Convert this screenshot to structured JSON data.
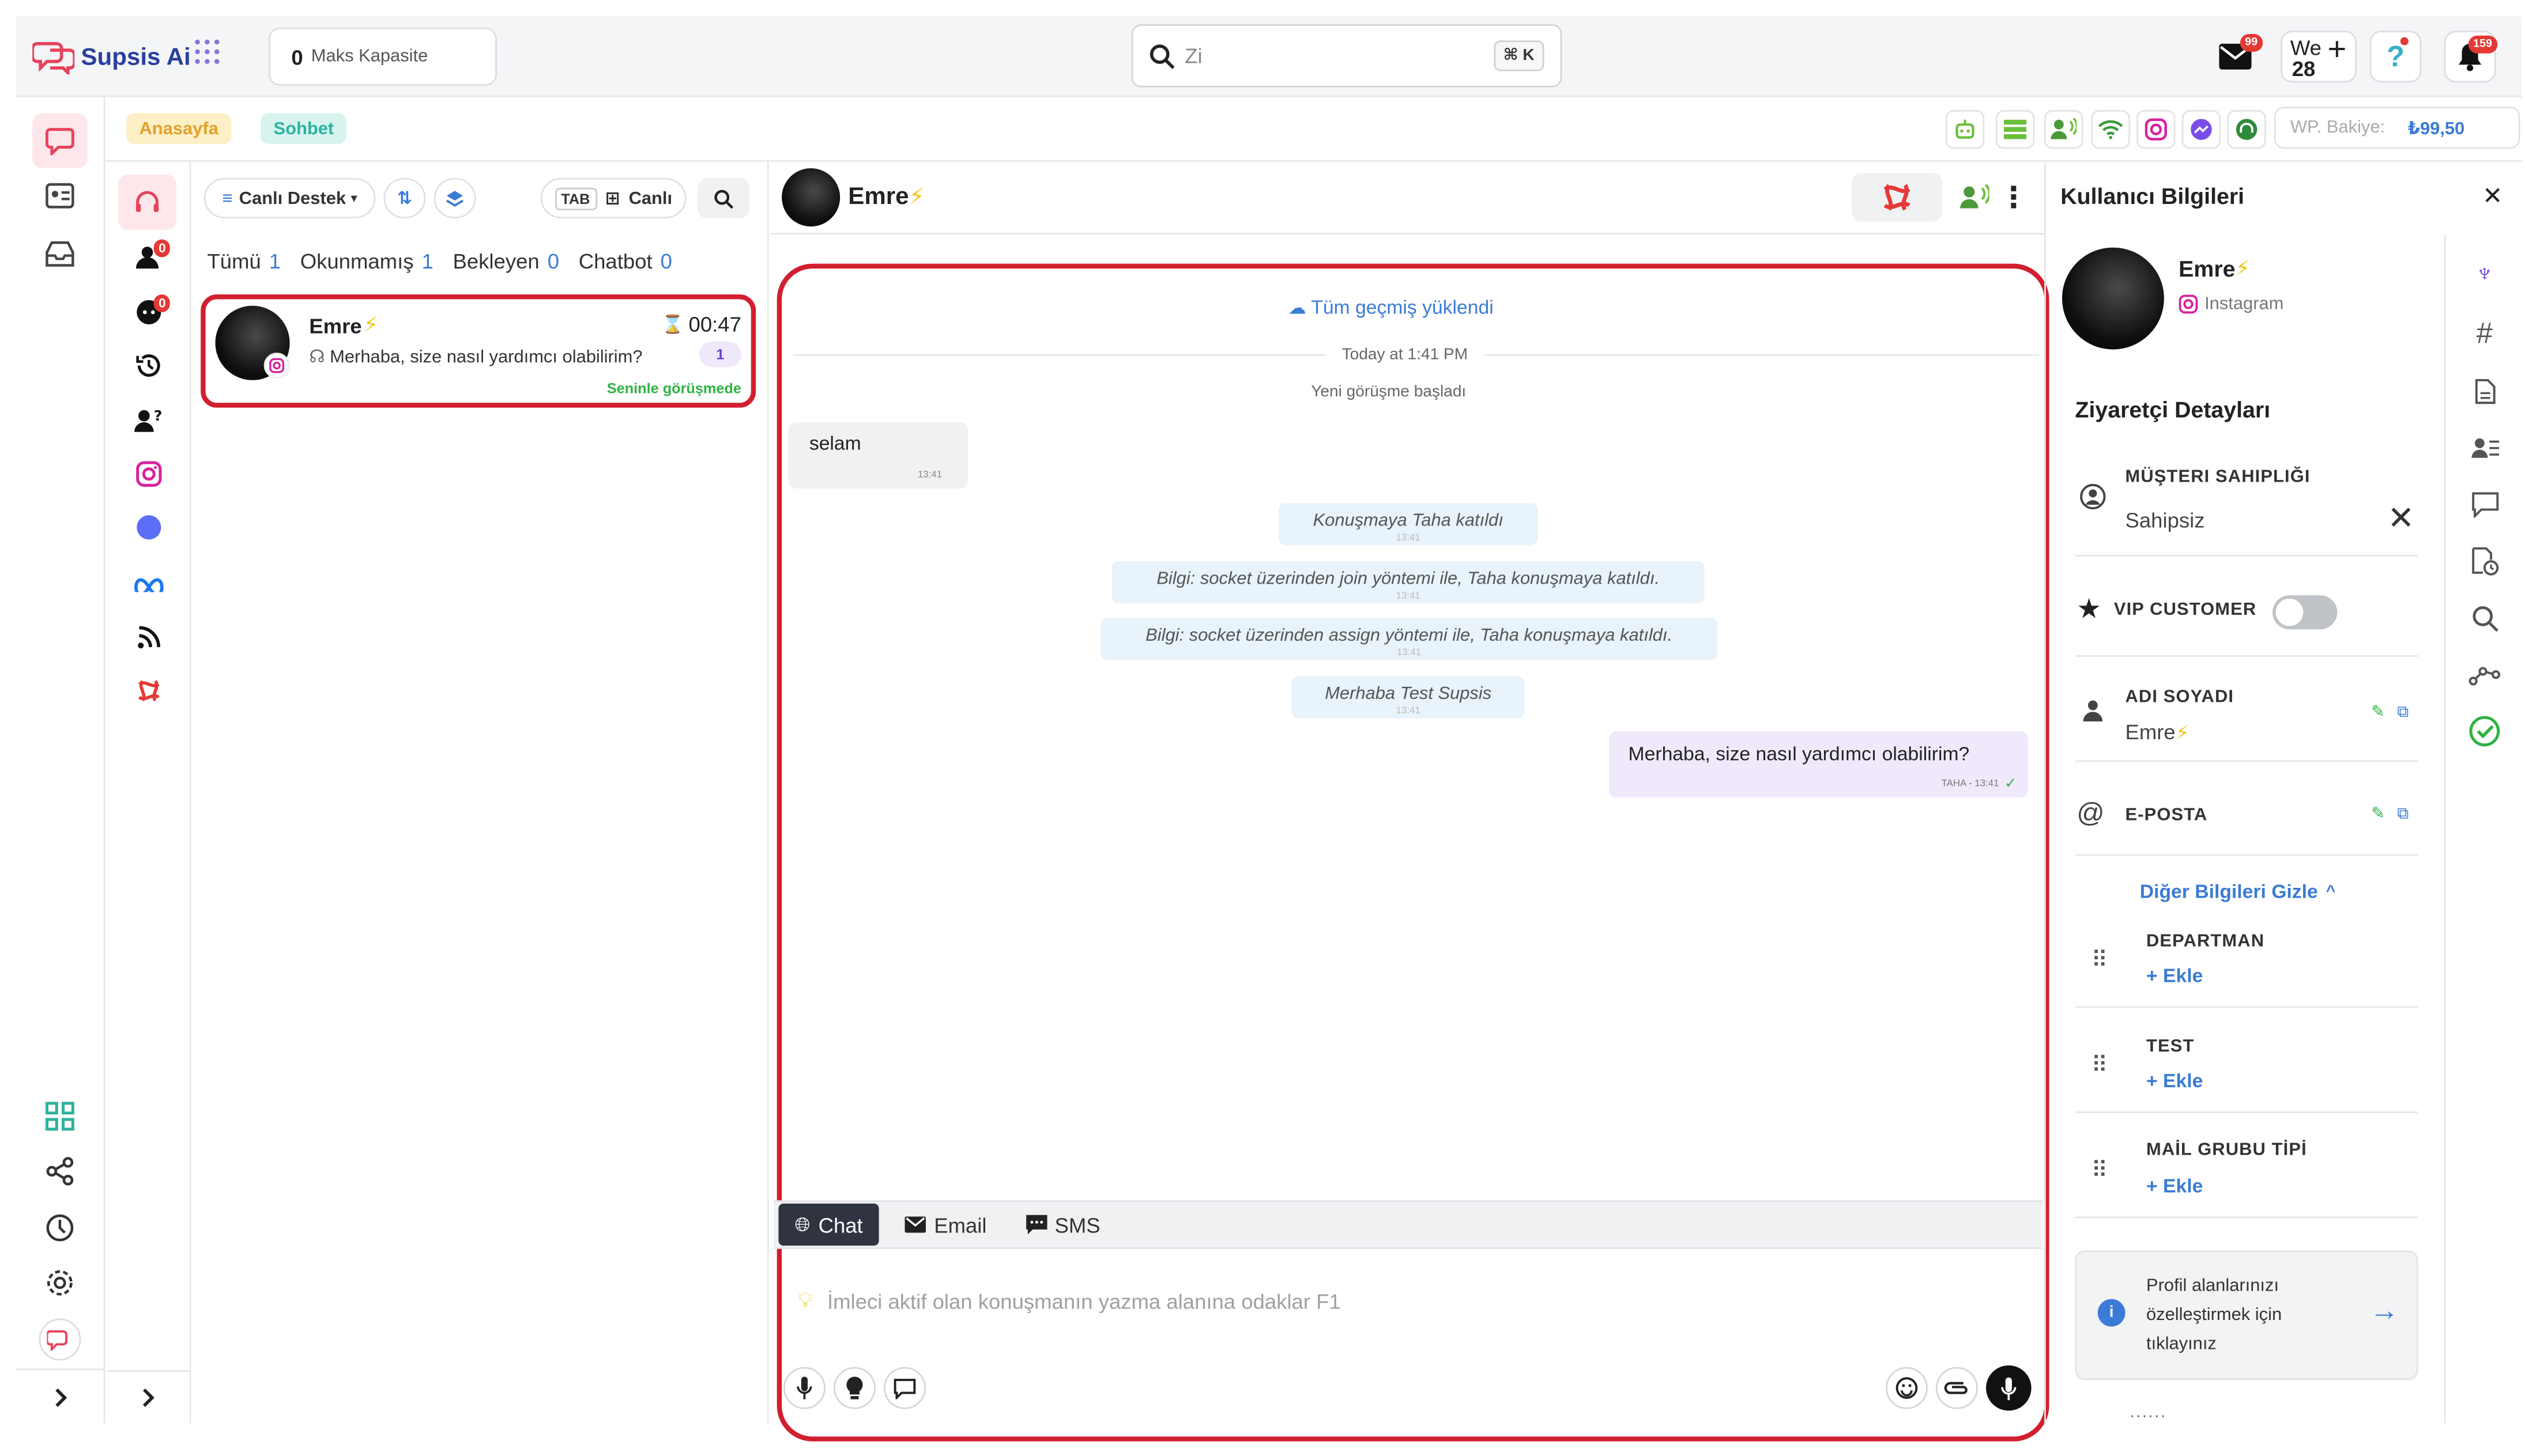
{
  "app": {
    "name": "Supsis Ai"
  },
  "capacity": {
    "value": "0",
    "label": "Maks Kapasite"
  },
  "search": {
    "value": "Zi",
    "shortcut": "⌘ K"
  },
  "topbar": {
    "mail_badge": "99",
    "date_top": "We",
    "date_day": "28",
    "notif_badge": "159"
  },
  "breadcrumb": {
    "home": "Anasayfa",
    "chat": "Sohbet"
  },
  "wallet": {
    "label": "WP. Bakiye:",
    "amount": "₺99,50"
  },
  "convlist": {
    "dept": "Canlı Destek",
    "tab_key": "TAB",
    "mode": "Canlı",
    "filters": [
      {
        "label": "Tümü",
        "count": "1"
      },
      {
        "label": "Okunmamış",
        "count": "1"
      },
      {
        "label": "Bekleyen",
        "count": "0"
      },
      {
        "label": "Chatbot",
        "count": "0"
      }
    ],
    "rail_badges": [
      "0",
      "0"
    ],
    "conversation": {
      "name": "Emre",
      "time": "00:47",
      "preview": "Merhaba, size nasıl yardımcı olabilirim?",
      "unread": "1",
      "status": "Seninle görüşmede"
    }
  },
  "chat": {
    "contact_name": "Emre",
    "history_loaded": "Tüm geçmiş yüklendi",
    "date_sep": "Today at 1:41 PM",
    "new_conv": "Yeni görüşme başladı",
    "incoming": {
      "text": "selam",
      "time": "13:41"
    },
    "system": [
      {
        "text": "Konuşmaya Taha katıldı",
        "time": "13:41"
      },
      {
        "text": "Bilgi: socket üzerinden join yöntemi ile, Taha konuşmaya katıldı.",
        "time": "13:41"
      },
      {
        "text": "Bilgi: socket üzerinden assign yöntemi ile, Taha konuşmaya katıldı.",
        "time": "13:41"
      },
      {
        "text": "Merhaba Test Supsis",
        "time": "13:41"
      }
    ],
    "outgoing": {
      "text": "Merhaba, size nasıl yardımcı olabilirim?",
      "meta": "TAHA - 13:41"
    },
    "tabs": [
      "Chat",
      "Email",
      "SMS"
    ],
    "placeholder": "İmleci aktif olan konuşmanın yazma alanına odaklar F1"
  },
  "user_panel": {
    "title": "Kullanıcı Bilgileri",
    "name": "Emre",
    "channel": "Instagram",
    "section": "Ziyaretçi Detayları",
    "ownership_label": "MÜŞTERI SAHIPLIĞI",
    "ownership_value": "Sahipsiz",
    "vip_label": "VIP CUSTOMER",
    "fullname_label": "ADI SOYADI",
    "fullname_value": "Emre",
    "email_label": "E-POSTA",
    "toggle_more": "Diğer Bilgileri Gizle",
    "fields": [
      {
        "label": "DEPARTMAN",
        "action": "+ Ekle"
      },
      {
        "label": "TEST",
        "action": "+ Ekle"
      },
      {
        "label": "MAİL GRUBU TİPİ",
        "action": "+ Ekle"
      }
    ],
    "info_card": "Profil alanlarınızı özelleştirmek için tıklayınız"
  },
  "colors": {
    "accent": "#3a7bd5",
    "highlight": "#d21f2f",
    "status_green": "#2fb344",
    "brand_pink": "#e8435d"
  }
}
